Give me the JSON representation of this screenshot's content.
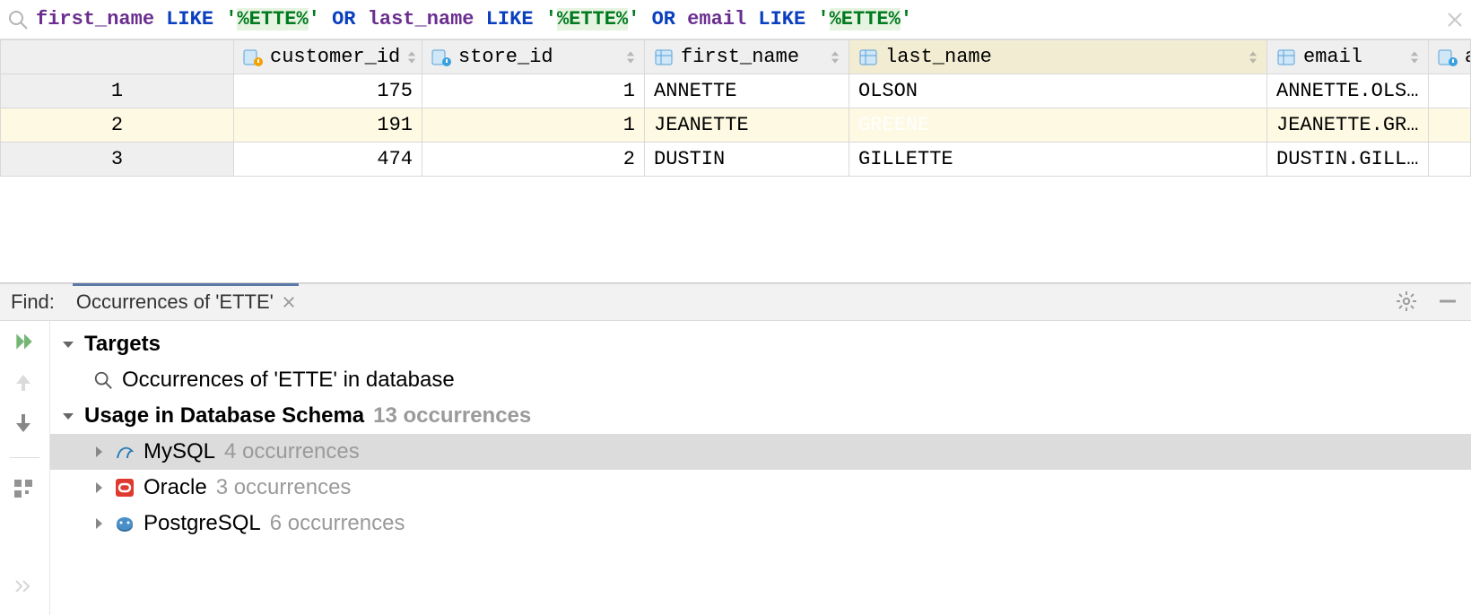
{
  "filter": {
    "tokens": [
      {
        "t": "col",
        "v": "first_name"
      },
      {
        "t": "sp"
      },
      {
        "t": "kw",
        "v": "LIKE"
      },
      {
        "t": "sp"
      },
      {
        "t": "str",
        "v": "'"
      },
      {
        "t": "pat",
        "v": "%ETTE%"
      },
      {
        "t": "str",
        "v": "'"
      },
      {
        "t": "sp2"
      },
      {
        "t": "kw",
        "v": "OR"
      },
      {
        "t": "sp"
      },
      {
        "t": "col",
        "v": "last_name"
      },
      {
        "t": "sp"
      },
      {
        "t": "kw",
        "v": "LIKE"
      },
      {
        "t": "sp"
      },
      {
        "t": "str",
        "v": "'"
      },
      {
        "t": "pat",
        "v": "%ETTE%"
      },
      {
        "t": "str",
        "v": "'"
      },
      {
        "t": "sp2"
      },
      {
        "t": "kw",
        "v": "OR"
      },
      {
        "t": "sp"
      },
      {
        "t": "col",
        "v": "email"
      },
      {
        "t": "sp"
      },
      {
        "t": "kw",
        "v": "LIKE"
      },
      {
        "t": "sp"
      },
      {
        "t": "str",
        "v": "'"
      },
      {
        "t": "pat",
        "v": "%ETTE%"
      },
      {
        "t": "str",
        "v": "'"
      }
    ]
  },
  "columns": [
    {
      "name": "customer_id",
      "icon": "pk"
    },
    {
      "name": "store_id",
      "icon": "fk"
    },
    {
      "name": "first_name",
      "icon": "col"
    },
    {
      "name": "last_name",
      "icon": "col",
      "highlight": true
    },
    {
      "name": "email",
      "icon": "col"
    },
    {
      "name": "addre",
      "icon": "fk",
      "truncated": true
    }
  ],
  "rows": [
    {
      "n": "1",
      "customer_id": "175",
      "store_id": "1",
      "first_name": "ANNETTE",
      "last_name": "OLSON",
      "email": "ANNETTE.OLSON@sakilacustomer.org"
    },
    {
      "n": "2",
      "customer_id": "191",
      "store_id": "1",
      "first_name": "JEANETTE",
      "last_name": "GREENE",
      "email": "JEANETTE.GREENE@sakilacustomer.o…",
      "highlight": true,
      "selected_col": "last_name"
    },
    {
      "n": "3",
      "customer_id": "474",
      "store_id": "2",
      "first_name": "DUSTIN",
      "last_name": "GILLETTE",
      "email": "DUSTIN.GILLETTE@sakilacustomer.o…"
    }
  ],
  "find": {
    "label": "Find:",
    "tab": "Occurrences of 'ETTE'",
    "targets_label": "Targets",
    "targets_desc": "Occurrences of 'ETTE' in database",
    "usage_label": "Usage in Database Schema",
    "usage_count": "13 occurrences",
    "items": [
      {
        "db": "MySQL",
        "icon": "mysql",
        "count": "4 occurrences",
        "selected": true
      },
      {
        "db": "Oracle",
        "icon": "oracle",
        "count": "3 occurrences"
      },
      {
        "db": "PostgreSQL",
        "icon": "postgres",
        "count": "6 occurrences"
      }
    ]
  }
}
